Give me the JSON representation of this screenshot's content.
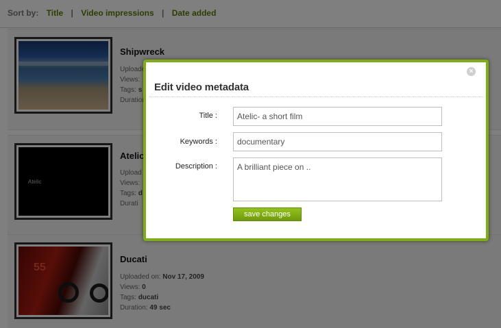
{
  "sort_bar": {
    "label": "Sort by:",
    "options": [
      "Title",
      "Video impressions",
      "Date added"
    ],
    "separator": "|"
  },
  "videos": [
    {
      "title": "Shipwreck",
      "uploaded_label": "Uploaded on:",
      "views_label": "Views:",
      "tags_label": "Tags:",
      "tags_value": "s",
      "duration_label": "Duration:"
    },
    {
      "title": "Atelic",
      "thumbnail_text": "Atelic",
      "uploaded_label": "Upload",
      "views_label": "Views:",
      "tags_label": "Tags:",
      "tags_value": "d",
      "duration_label": "Durati"
    },
    {
      "title": "Ducati",
      "thumbnail_text": "55",
      "uploaded_label": "Uploaded on:",
      "uploaded_value": "Nov 17, 2009",
      "views_label": "Views:",
      "views_value": "0",
      "tags_label": "Tags:",
      "tags_value": "ducati",
      "duration_label": "Duration:",
      "duration_value": "49 sec"
    }
  ],
  "modal": {
    "title": "Edit video metadata",
    "close_symbol": "×",
    "fields": {
      "title_label": "Title :",
      "title_value": "Atelic- a short film",
      "keywords_label": "Keywords :",
      "keywords_value": "documentary",
      "description_label": "Description :",
      "description_value": "A brilliant piece on .."
    },
    "save_label": "save changes"
  },
  "colors": {
    "accent": "#7fae10",
    "link": "#5a7a00",
    "button": "#78a312",
    "overlay": "rgba(0,0,0,0.5)"
  }
}
